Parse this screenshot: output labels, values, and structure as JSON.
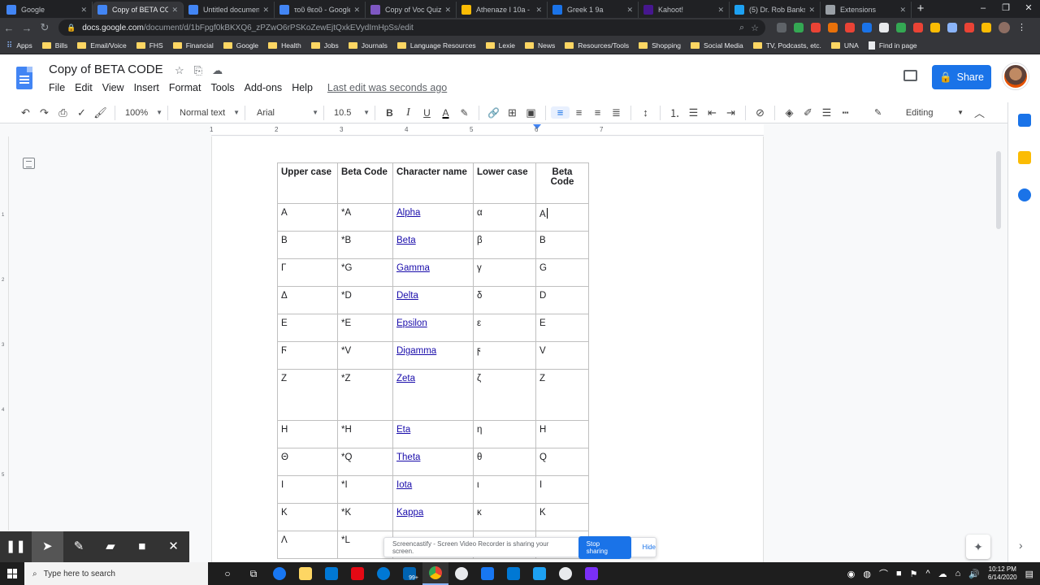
{
  "browser": {
    "tabs": [
      {
        "title": "Google",
        "color": "#4285f4",
        "active": false
      },
      {
        "title": "Copy of BETA CODE",
        "color": "#4285f4",
        "active": true
      },
      {
        "title": "Untitled document",
        "color": "#4285f4",
        "active": false
      },
      {
        "title": "τοῦ θεοῦ - Google",
        "color": "#4285f4",
        "active": false
      },
      {
        "title": "Copy of Voc Quiz 2",
        "color": "#7e57c2",
        "active": false
      },
      {
        "title": "Athenaze I 10a - G",
        "color": "#fbbc04",
        "active": false
      },
      {
        "title": "Greek 1 9a",
        "color": "#1a73e8",
        "active": false
      },
      {
        "title": "Kahoot!",
        "color": "#46178f",
        "active": false
      },
      {
        "title": "(5) Dr. Rob Banks o",
        "color": "#1da1f2",
        "active": false
      },
      {
        "title": "Extensions",
        "color": "#9aa0a6",
        "active": false
      }
    ],
    "url": "docs.google.com",
    "url_path": "/document/d/1bFpgf0kBKXQ6_zPZwO6rPSKoZewEjtQxkEVydImHpSs/edit",
    "bookmarks": [
      {
        "label": "Apps",
        "kind": "apps"
      },
      {
        "label": "Bills",
        "kind": "folder"
      },
      {
        "label": "Email/Voice",
        "kind": "folder"
      },
      {
        "label": "FHS",
        "kind": "folder"
      },
      {
        "label": "Financial",
        "kind": "folder"
      },
      {
        "label": "Google",
        "kind": "folder"
      },
      {
        "label": "Health",
        "kind": "folder"
      },
      {
        "label": "Jobs",
        "kind": "folder"
      },
      {
        "label": "Journals",
        "kind": "folder"
      },
      {
        "label": "Language Resources",
        "kind": "folder"
      },
      {
        "label": "Lexie",
        "kind": "folder"
      },
      {
        "label": "News",
        "kind": "folder"
      },
      {
        "label": "Resources/Tools",
        "kind": "folder"
      },
      {
        "label": "Shopping",
        "kind": "folder"
      },
      {
        "label": "Social Media",
        "kind": "folder"
      },
      {
        "label": "TV, Podcasts, etc.",
        "kind": "folder"
      },
      {
        "label": "UNA",
        "kind": "folder"
      },
      {
        "label": "Find in page",
        "kind": "page"
      }
    ]
  },
  "docs": {
    "title": "Copy of BETA CODE",
    "menus": [
      "File",
      "Edit",
      "View",
      "Insert",
      "Format",
      "Tools",
      "Add-ons",
      "Help"
    ],
    "last_edit": "Last edit was seconds ago",
    "share_label": "Share",
    "zoom": "100%",
    "style": "Normal text",
    "font": "Arial",
    "font_size": "10.5",
    "mode": "Editing",
    "ruler_numbers": [
      "1",
      "2",
      "3",
      "4",
      "5",
      "6",
      "7"
    ]
  },
  "table": {
    "headers": [
      "Upper case",
      "Beta Code",
      "Character name",
      "Lower case",
      "Beta Code"
    ],
    "rows": [
      {
        "upper": "Α",
        "beta": "*A",
        "name": "Alpha",
        "lower": "α",
        "beta_lower": "A"
      },
      {
        "upper": "Β",
        "beta": "*B",
        "name": "Beta",
        "lower": "β",
        "beta_lower": "B"
      },
      {
        "upper": "Γ",
        "beta": "*G",
        "name": "Gamma",
        "lower": "γ",
        "beta_lower": "G"
      },
      {
        "upper": "Δ",
        "beta": "*D",
        "name": "Delta",
        "lower": "δ",
        "beta_lower": "D"
      },
      {
        "upper": "Ε",
        "beta": "*E",
        "name": "Epsilon",
        "lower": "ε",
        "beta_lower": "E"
      },
      {
        "upper": "Ϝ",
        "beta": "*V",
        "name": "Digamma",
        "lower": "ϝ",
        "beta_lower": "V"
      },
      {
        "upper": "Ζ",
        "beta": "*Z",
        "name": "Zeta",
        "lower": "ζ",
        "beta_lower": "Z"
      },
      {
        "upper": "Η",
        "beta": "*H",
        "name": "Eta",
        "lower": "η",
        "beta_lower": "H"
      },
      {
        "upper": "Θ",
        "beta": "*Q",
        "name": "Theta",
        "lower": "θ",
        "beta_lower": "Q"
      },
      {
        "upper": "Ι",
        "beta": "*I",
        "name": "Iota",
        "lower": "ι",
        "beta_lower": "I"
      },
      {
        "upper": "Κ",
        "beta": "*K",
        "name": "Kappa",
        "lower": "κ",
        "beta_lower": "K"
      },
      {
        "upper": "Λ",
        "beta": "*L",
        "name": "",
        "lower": "",
        "beta_lower": ""
      }
    ]
  },
  "screencastify": {
    "message": "Screencastify - Screen Video Recorder is sharing your screen.",
    "stop_label": "Stop sharing",
    "hide_label": "Hide"
  },
  "taskbar": {
    "search_placeholder": "Type here to search",
    "time": "10:12 PM",
    "date": "6/14/2020",
    "badge": "99+"
  }
}
